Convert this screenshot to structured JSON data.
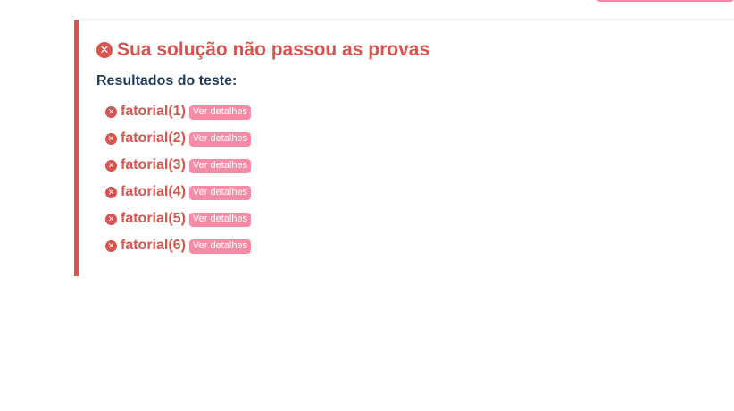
{
  "colors": {
    "error": "#d9534f",
    "heading": "#1f3b57",
    "badge": "#f48ca6"
  },
  "icons": {
    "fail": "times-circle-icon"
  },
  "result": {
    "title": "Sua solução não passou as provas",
    "subtitle": "Resultados do teste:",
    "tests": [
      {
        "name": "fatorial(1)",
        "details_label": "Ver detalhes"
      },
      {
        "name": "fatorial(2)",
        "details_label": "Ver detalhes"
      },
      {
        "name": "fatorial(3)",
        "details_label": "Ver detalhes"
      },
      {
        "name": "fatorial(4)",
        "details_label": "Ver detalhes"
      },
      {
        "name": "fatorial(5)",
        "details_label": "Ver detalhes"
      },
      {
        "name": "fatorial(6)",
        "details_label": "Ver detalhes"
      }
    ]
  }
}
